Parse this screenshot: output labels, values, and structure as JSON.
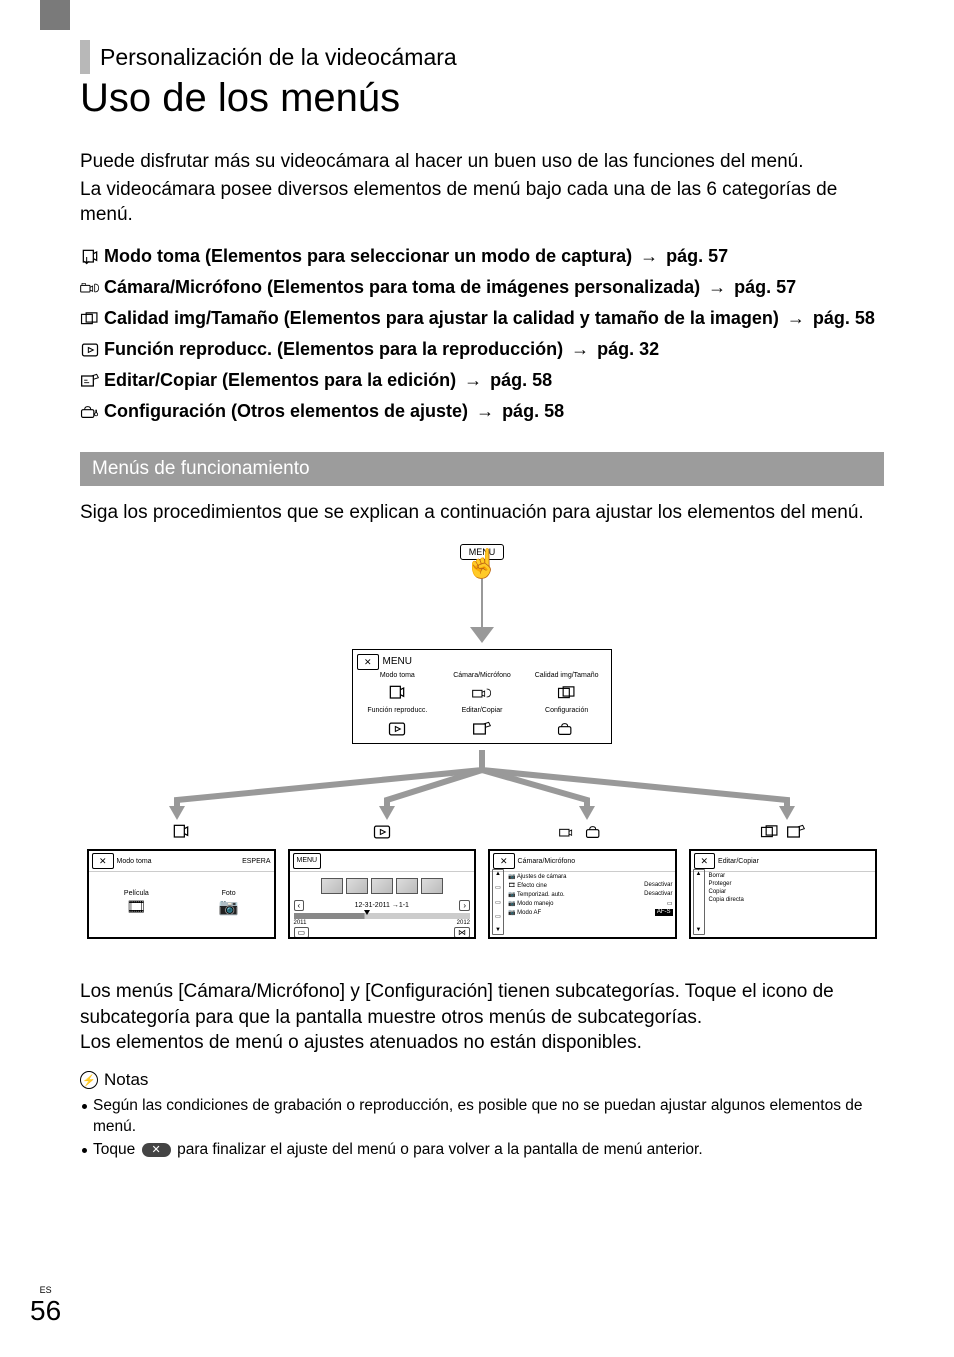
{
  "chapter": "Personalización de la videocámara",
  "title": "Uso de los menús",
  "intro": [
    "Puede disfrutar más su videocámara al hacer un buen uso de las funciones del menú.",
    "La videocámara posee diversos elementos de menú bajo cada una de las 6 categorías de menú."
  ],
  "arrow": "→",
  "categories": [
    {
      "icon": "⬐",
      "label": "Modo toma (Elementos para seleccionar un modo de captura)",
      "page": "pág. 57"
    },
    {
      "icon": "📷",
      "label": "Cámara/Micrófono (Elementos para toma de imágenes personalizada)",
      "page": "pág. 57"
    },
    {
      "icon": "⬚",
      "label": "Calidad img/Tamaño (Elementos para ajustar la calidad y tamaño de la imagen)",
      "page": "pág. 58"
    },
    {
      "icon": "▶",
      "label": "Función reproducc. (Elementos para la reproducción)",
      "page": "pág. 32"
    },
    {
      "icon": "✎",
      "label": "Editar/Copiar (Elementos para la edición)",
      "page": "pág. 58"
    },
    {
      "icon": "🧰",
      "label": "Configuración (Otros elementos de ajuste)",
      "page": "pág. 58"
    }
  ],
  "section_title": "Menús de funcionamiento",
  "section_desc": "Siga los procedimientos que se explican a continuación para ajustar los elementos del menú.",
  "menu_button": "MENU",
  "close_x": "✕",
  "menu_overview": {
    "title": "MENU",
    "cells": [
      {
        "label": "Modo toma"
      },
      {
        "label": "Cámara/Micrófono"
      },
      {
        "label": "Calidad img/Tamaño"
      },
      {
        "label": "Función reproducc."
      },
      {
        "label": "Editar/Copiar"
      },
      {
        "label": "Configuración"
      }
    ]
  },
  "screens": {
    "s1": {
      "header_left": "Modo toma",
      "header_right": "ESPERA",
      "opt1": "Película",
      "opt2": "Foto"
    },
    "s2": {
      "header": "MENU",
      "date": "12-31-2011",
      "date_to": "1-1",
      "year_left": "2011",
      "year_right": "2012"
    },
    "s3": {
      "header": "Cámara/Micrófono",
      "rows": [
        {
          "l": "Ajustes de cámara",
          "r": ""
        },
        {
          "l": "Efecto cine",
          "r": "Desactivar"
        },
        {
          "l": "Temporizad. auto.",
          "r": "Desactivar"
        },
        {
          "l": "Modo manejo",
          "r": "▭"
        },
        {
          "l": "Modo AF",
          "r": "AF-S"
        }
      ]
    },
    "s4": {
      "header": "Editar/Copiar",
      "rows": [
        "Borrar",
        "Proteger",
        "Copiar",
        "Copia directa"
      ]
    }
  },
  "bottom_paragraphs": [
    "Los menús [Cámara/Micrófono] y [Configuración] tienen subcategorías. Toque el icono de subcategoría para que la pantalla muestre otros menús de subcategorías.",
    "Los elementos de menú o ajustes atenuados no están disponibles."
  ],
  "notes_label": "Notas",
  "notes": [
    "Según las condiciones de grabación o reproducción, es posible que no se puedan ajustar algunos elementos de menú.",
    "Toque ✕ para finalizar el ajuste del menú o para volver a la pantalla de menú anterior."
  ],
  "note2_prefix": "Toque",
  "note2_suffix": "para finalizar el ajuste del menú o para volver a la pantalla de menú anterior.",
  "page_lang": "ES",
  "page_number": "56"
}
